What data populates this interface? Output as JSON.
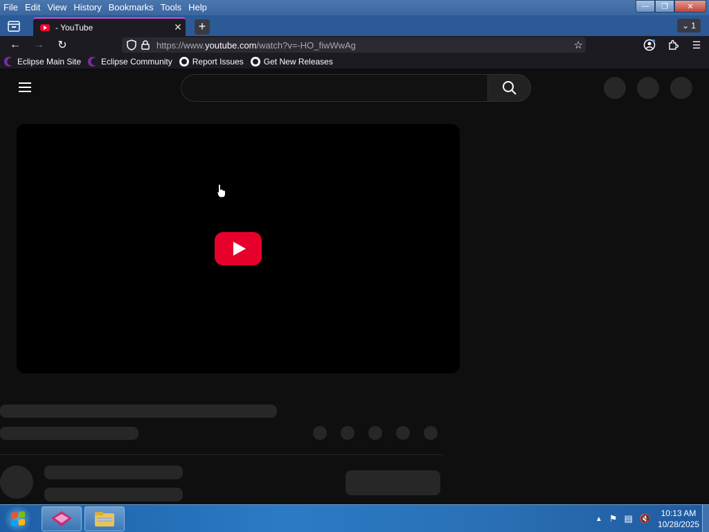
{
  "window": {
    "menu": [
      "File",
      "Edit",
      "View",
      "History",
      "Bookmarks",
      "Tools",
      "Help"
    ],
    "controls": [
      "minimize-icon",
      "restore-icon",
      "close-icon"
    ]
  },
  "tabs": {
    "active_title": "- YouTube",
    "close": "✕",
    "new_tab": "+",
    "list_count": "1"
  },
  "navbar": {
    "url_prefix": "https://www.",
    "url_domain": "youtube.com",
    "url_path": "/watch?v=-HO_fiwWwAg"
  },
  "bookmarks": [
    {
      "label": "Eclipse Main Site",
      "icon": "eclipse-icon"
    },
    {
      "label": "Eclipse Community",
      "icon": "eclipse-icon"
    },
    {
      "label": "Report Issues",
      "icon": "github-icon"
    },
    {
      "label": "Get New Releases",
      "icon": "github-icon"
    }
  ],
  "taskbar": {
    "time": "10:13 AM",
    "date": "10/28/2025"
  },
  "colors": {
    "youtube_red": "#e8002d",
    "tab_accent": "#d04cd6",
    "page_bg": "#0f0f0f"
  }
}
